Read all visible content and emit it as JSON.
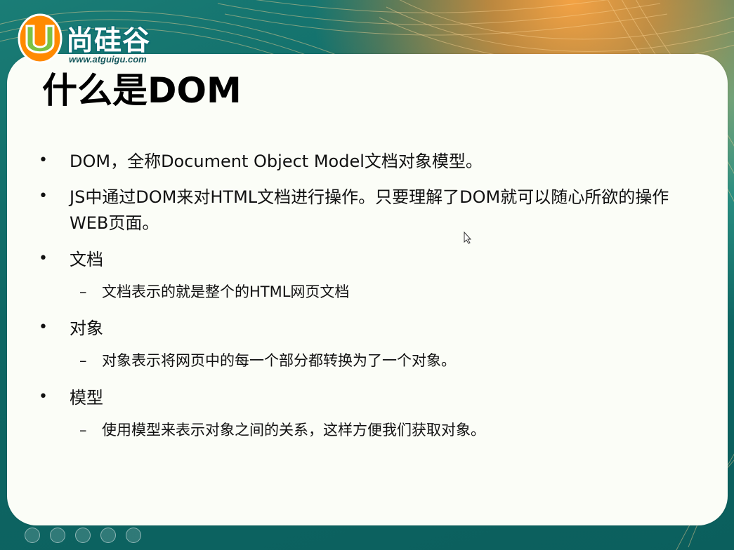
{
  "logo": {
    "mark": "U",
    "name": "尚硅谷",
    "url": "www.atguigu.com"
  },
  "slide": {
    "title": "什么是DOM",
    "bullets": [
      {
        "marker": "•",
        "text": "DOM，全称Document Object Model文档对象模型。"
      },
      {
        "marker": "•",
        "text": "JS中通过DOM来对HTML文档进行操作。只要理解了DOM就可以随心所欲的操作WEB页面。"
      },
      {
        "marker": "•",
        "text": "文档",
        "sub_marker": "–",
        "sub_text": "文档表示的就是整个的HTML网页文档"
      },
      {
        "marker": "•",
        "text": "对象",
        "sub_marker": "–",
        "sub_text": "对象表示将网页中的每一个部分都转换为了一个对象。"
      },
      {
        "marker": "•",
        "text": "模型",
        "sub_marker": "–",
        "sub_text": "使用模型来表示对象之间的关系，这样方便我们获取对象。"
      }
    ]
  },
  "theme": {
    "background": "#0f6f6e",
    "accent": "#ff9a30",
    "card": "#fbfdf7",
    "logo_green": "#7cc242",
    "logo_orange": "#ff8a00"
  },
  "icons": {
    "cursor": "arrow-cursor-icon",
    "nav": [
      "previous-slide-icon",
      "next-slide-icon",
      "menu-icon",
      "pen-icon",
      "zoom-icon"
    ]
  }
}
